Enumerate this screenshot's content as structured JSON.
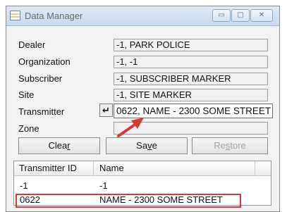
{
  "window": {
    "title": "Data Manager",
    "controls": {
      "minimize": "▭",
      "maximize": "▢",
      "close": "✕"
    }
  },
  "fields": [
    {
      "label": "Dealer",
      "value": "-1, PARK POLICE"
    },
    {
      "label": "Organization",
      "value": "-1, -1"
    },
    {
      "label": "Subscriber",
      "value": "-1, SUBSCRIBER MARKER"
    },
    {
      "label": "Site",
      "value": "-1, SITE MARKER"
    },
    {
      "label": "Transmitter",
      "value": "0622, NAME - 2300 SOME STREET"
    },
    {
      "label": "Zone",
      "value": ""
    }
  ],
  "transmitter_enter_symbol": "↵",
  "buttons": {
    "clear": {
      "pre": "Clea",
      "underline": "r",
      "post": ""
    },
    "save": {
      "pre": "Sa",
      "underline": "v",
      "post": "e"
    },
    "restore": {
      "pre": "Re",
      "underline": "s",
      "post": "tore"
    }
  },
  "list": {
    "headers": {
      "id": "Transmitter ID",
      "name": "Name"
    },
    "rows": [
      {
        "id": "-1",
        "name": "-1"
      },
      {
        "id": "0622",
        "name": "NAME - 2300 SOME STREET"
      }
    ]
  },
  "annotation_color": "#d43a3a"
}
